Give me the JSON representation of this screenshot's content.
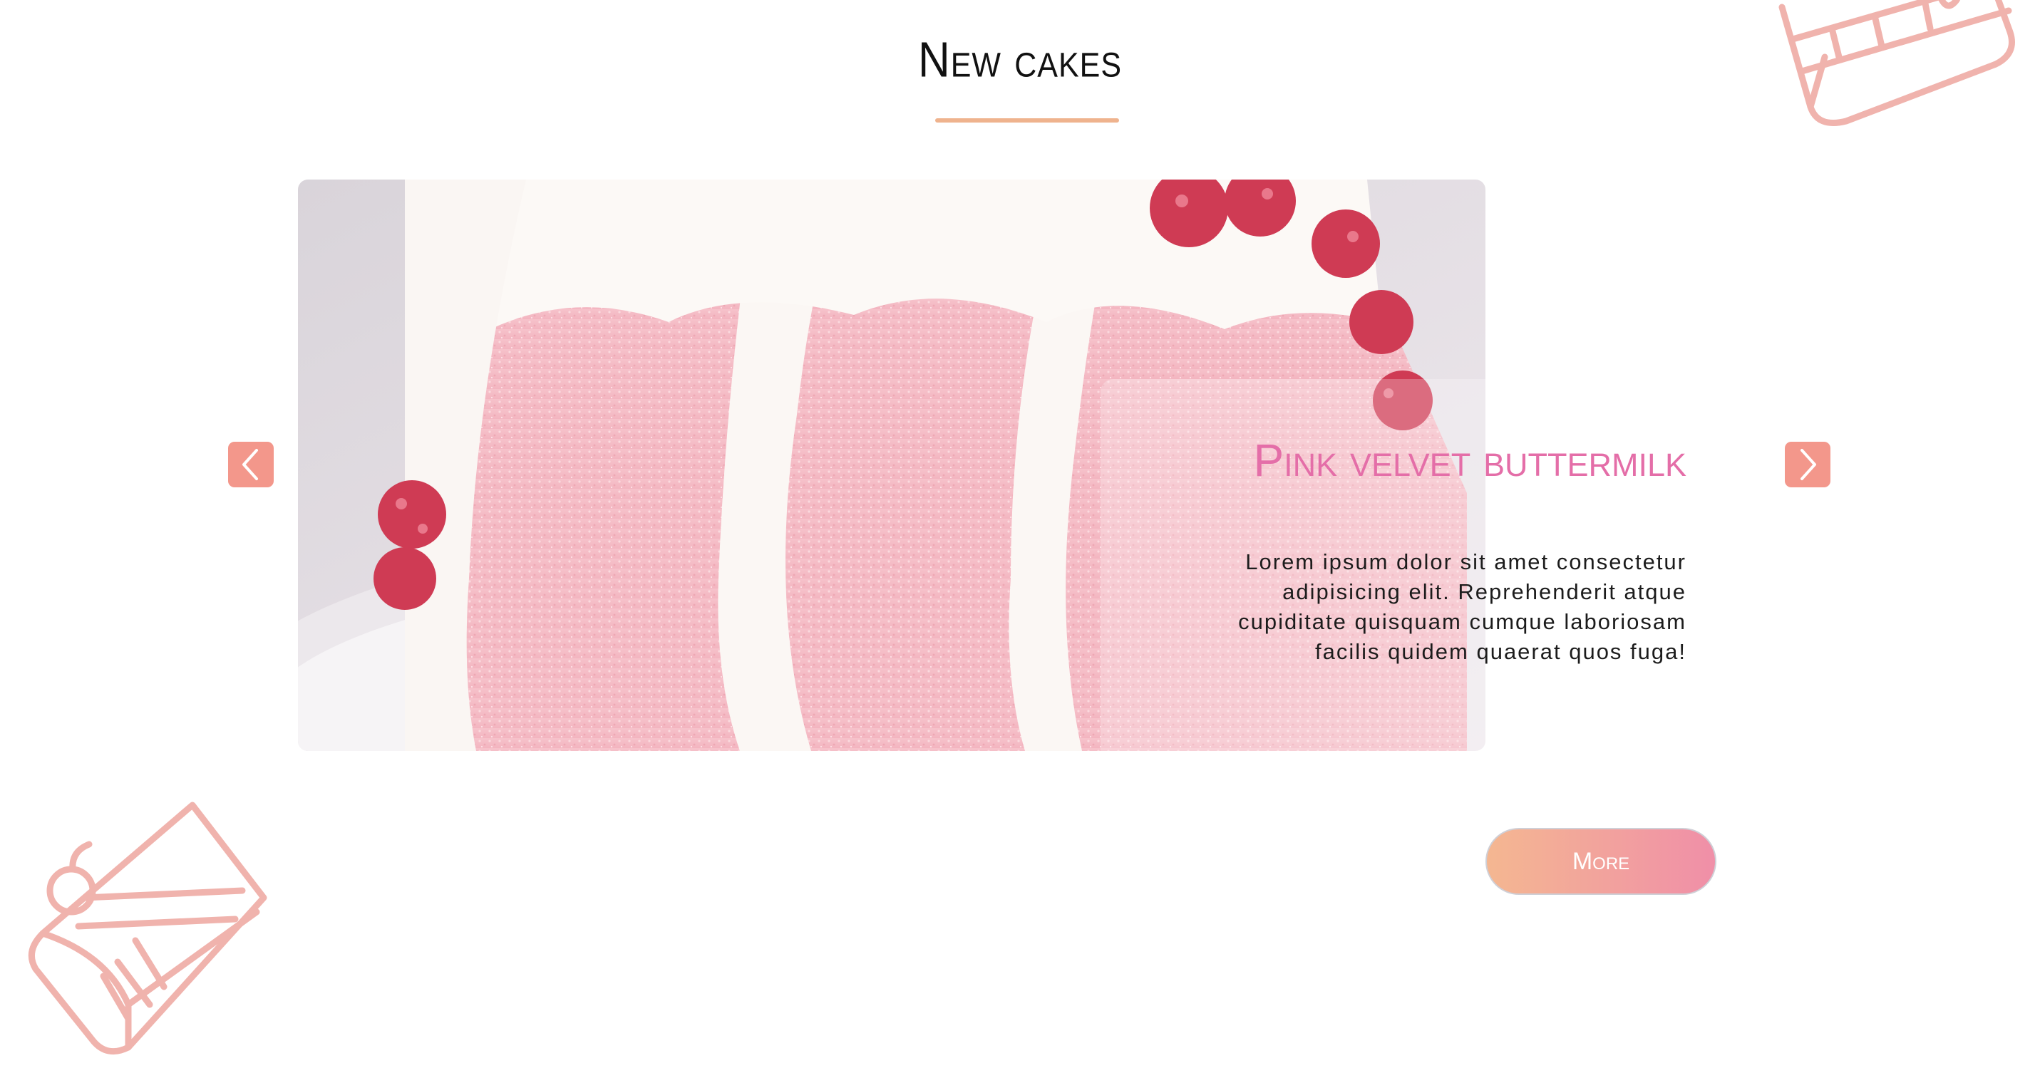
{
  "section": {
    "title": "New cakes"
  },
  "slide": {
    "title": "Pink velvet buttermilk",
    "description": "Lorem ipsum dolor sit amet consectetur adipisicing elit. Reprehenderit atque cupiditate quisquam cumque laboriosam facilis quidem quaerat quos fuga!"
  },
  "controls": {
    "prev_icon": "chevron-left-icon",
    "next_icon": "chevron-right-icon",
    "more_label": "More"
  },
  "colors": {
    "accent_underline": "#efb38e",
    "title_pink": "#e46ea8",
    "arrow_bg": "#f3978b",
    "button_gradient_start": "#f4b791",
    "button_gradient_end": "#f08fa8",
    "decor_line": "#f0b3ad"
  }
}
